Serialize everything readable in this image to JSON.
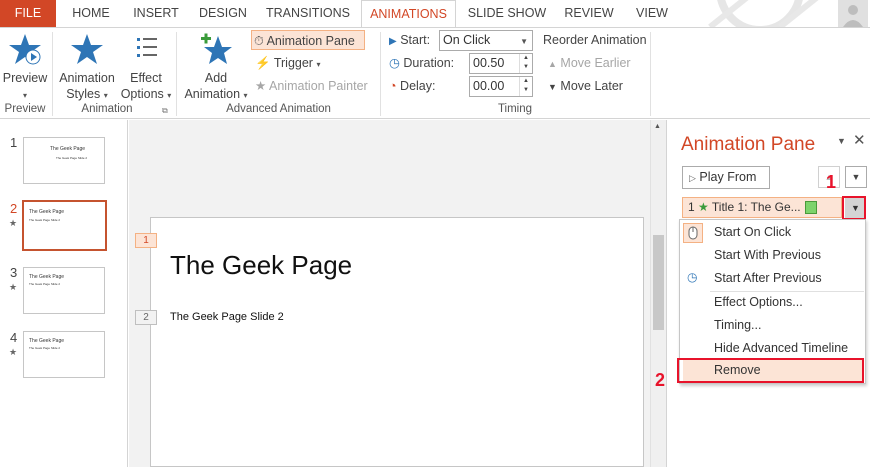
{
  "tabs": [
    {
      "label": "FILE"
    },
    {
      "label": "HOME"
    },
    {
      "label": "INSERT"
    },
    {
      "label": "DESIGN"
    },
    {
      "label": "TRANSITIONS"
    },
    {
      "label": "ANIMATIONS"
    },
    {
      "label": "SLIDE SHOW"
    },
    {
      "label": "REVIEW"
    },
    {
      "label": "VIEW"
    }
  ],
  "ribbon": {
    "preview": {
      "label": "Preview",
      "group": "Preview"
    },
    "animation_styles": {
      "label1": "Animation",
      "label2": "Styles"
    },
    "effect_options": {
      "label1": "Effect",
      "label2": "Options"
    },
    "animation_group": "Animation",
    "add_animation": {
      "label1": "Add",
      "label2": "Animation"
    },
    "animation_pane_btn": "Animation Pane",
    "trigger": "Trigger",
    "animation_painter": "Animation Painter",
    "advanced_group": "Advanced Animation",
    "start_label": "Start:",
    "start_value": "On Click",
    "duration_label": "Duration:",
    "duration_value": "00.50",
    "delay_label": "Delay:",
    "delay_value": "00.00",
    "timing_group": "Timing",
    "reorder": "Reorder Animation",
    "move_earlier": "Move Earlier",
    "move_later": "Move Later"
  },
  "thumbnails": [
    {
      "num": "1",
      "title": "The Geek Page",
      "sub": "The Geek Page Slide 2",
      "star": false
    },
    {
      "num": "2",
      "title": "The Geek Page",
      "sub": "The Geek Page Slide 2",
      "star": true
    },
    {
      "num": "3",
      "title": "The Geek Page",
      "sub": "The Geek Page Slide 2",
      "star": true
    },
    {
      "num": "4",
      "title": "The Geek Page",
      "sub": "The Geek Page Slide 2",
      "star": true
    }
  ],
  "slide": {
    "tag1": "1",
    "title": "The Geek Page",
    "tag2": "2",
    "subtitle": "The Geek Page Slide 2"
  },
  "pane": {
    "title": "Animation Pane",
    "play_from": "Play From",
    "item_num": "1",
    "item_label": "Title 1: The Ge...",
    "callout1": "1",
    "callout2": "2"
  },
  "context_menu": {
    "items": [
      {
        "label": "Start On Click"
      },
      {
        "label": "Start With Previous"
      },
      {
        "label": "Start After Previous"
      },
      {
        "label": "Effect Options..."
      },
      {
        "label": "Timing..."
      },
      {
        "label": "Hide Advanced Timeline"
      },
      {
        "label": "Remove"
      }
    ]
  },
  "colors": {
    "accent": "#d24726",
    "callout": "#e8132b",
    "highlight": "#fce4d6"
  }
}
